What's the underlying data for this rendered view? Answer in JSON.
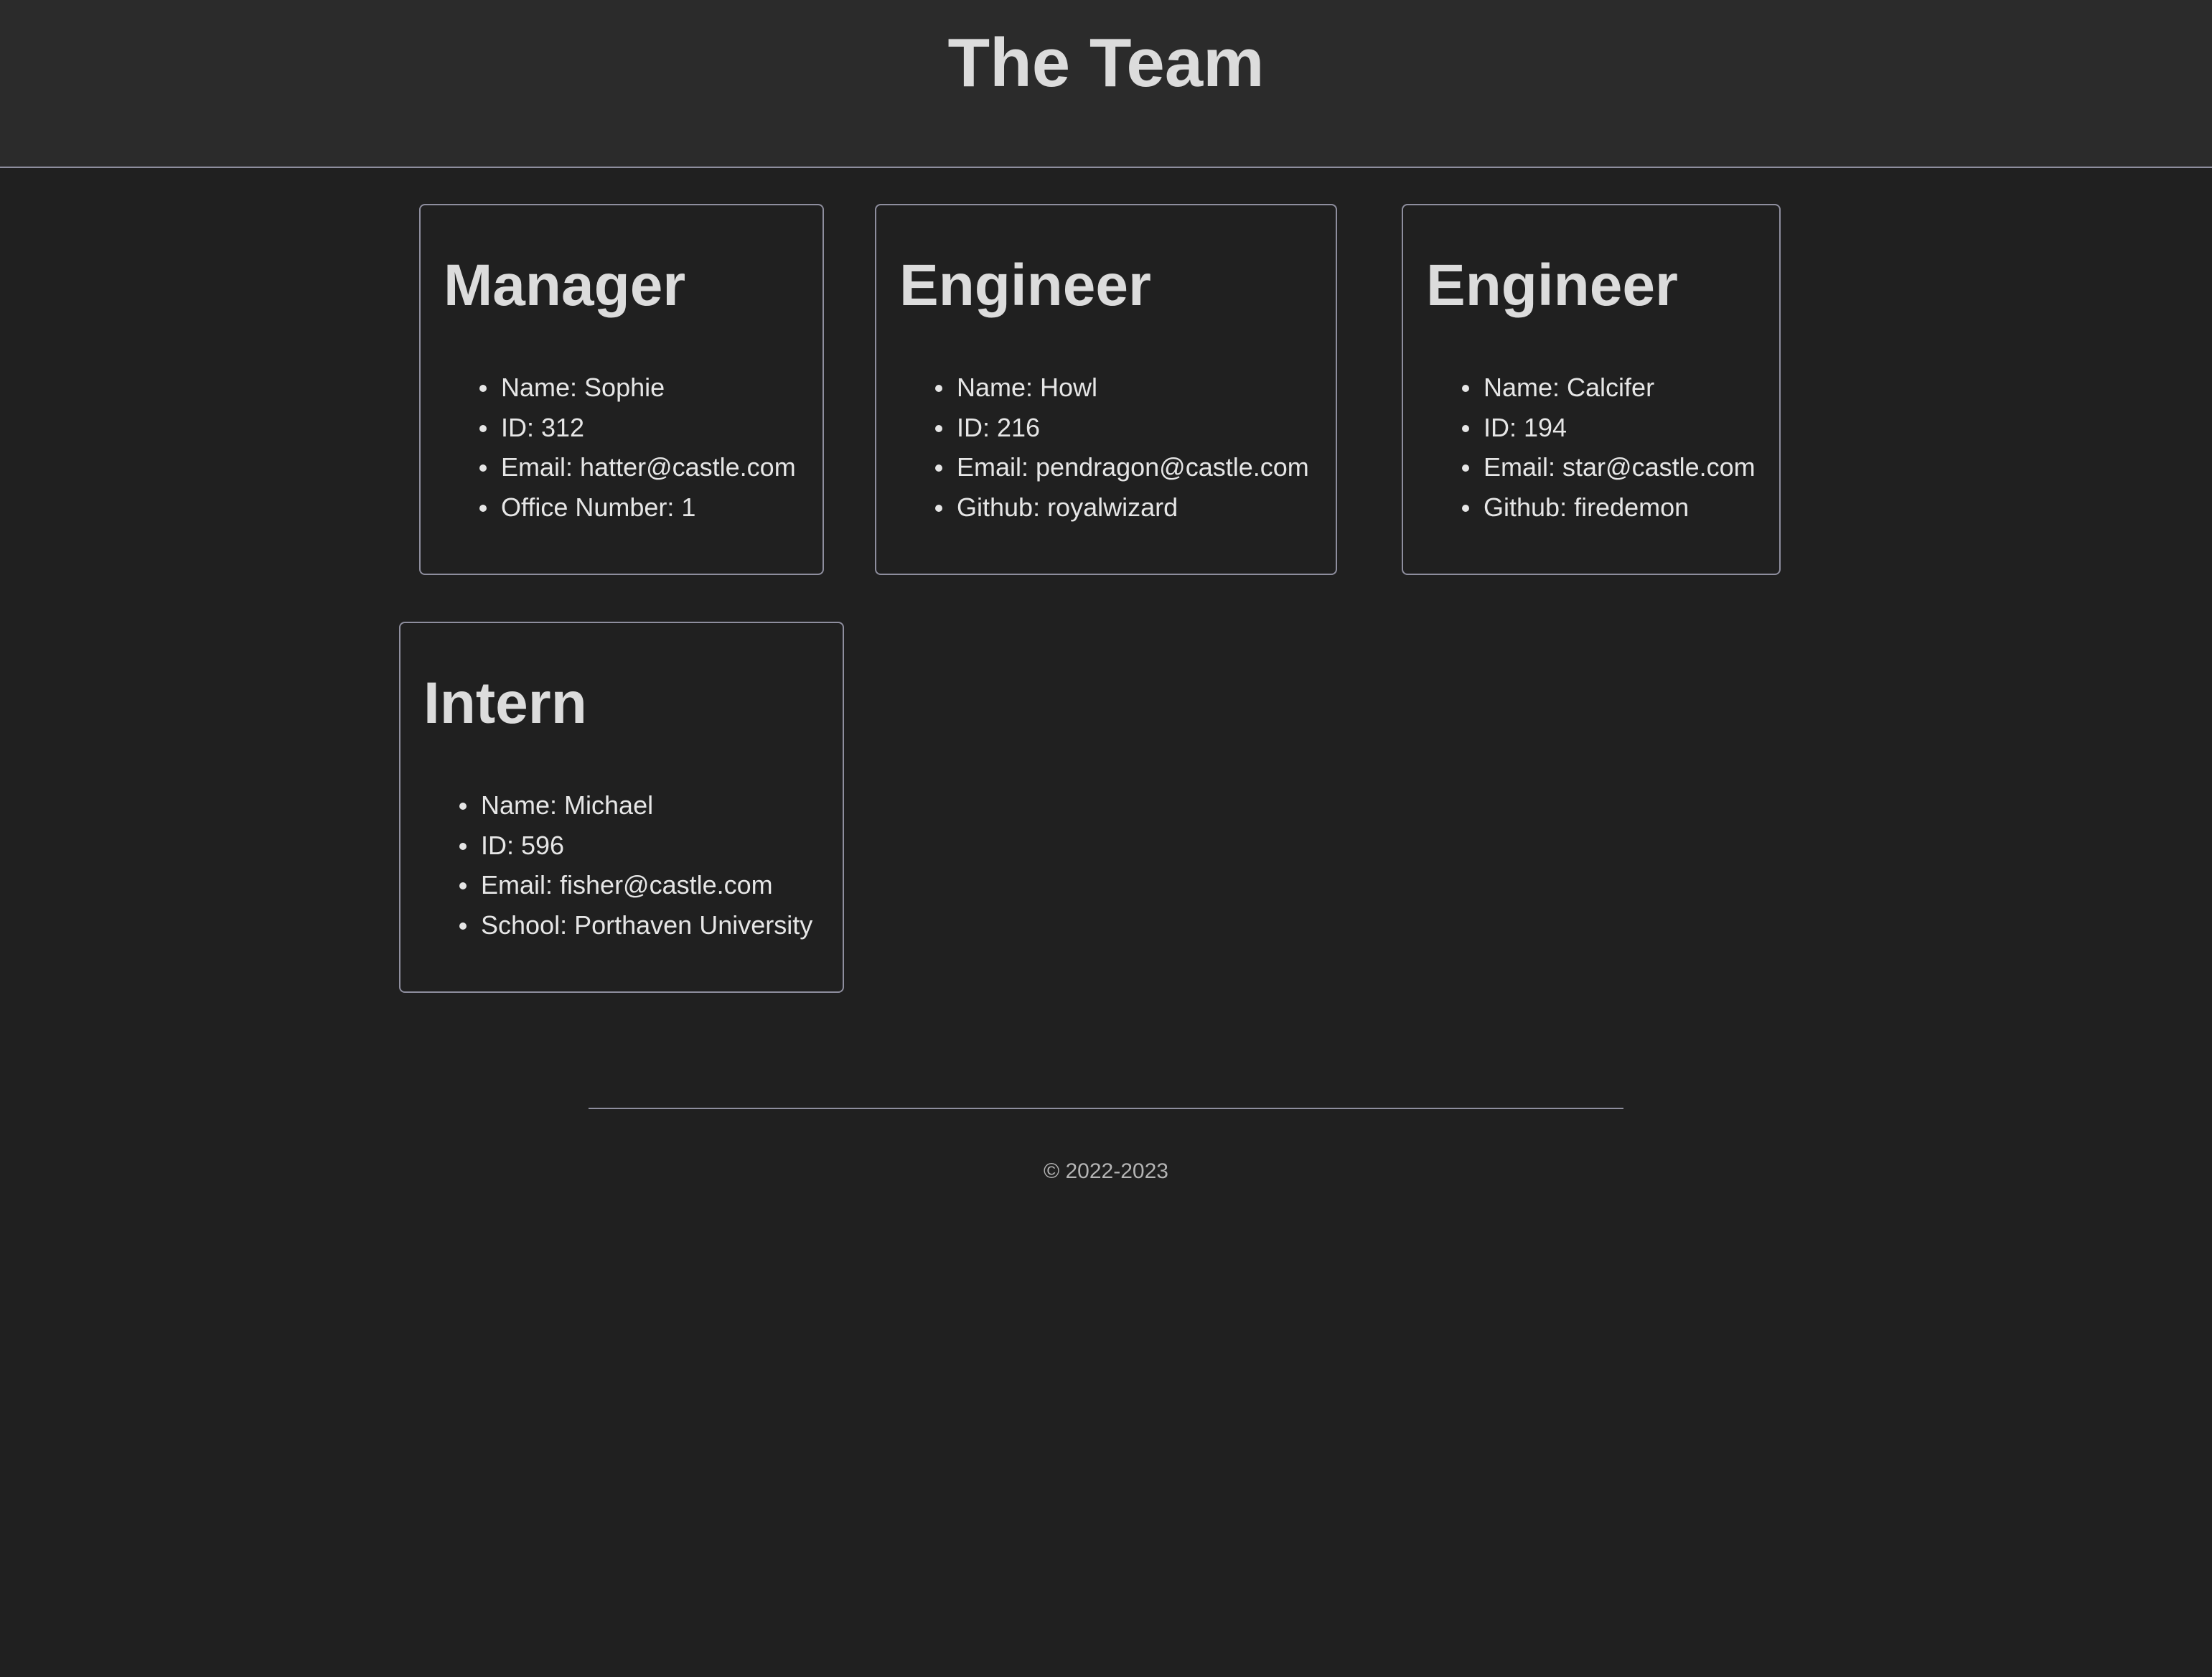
{
  "header": {
    "title": "The Team"
  },
  "cards": [
    {
      "role": "Manager",
      "items": [
        "Name: Sophie",
        "ID: 312",
        "Email: hatter@castle.com",
        "Office Number: 1"
      ]
    },
    {
      "role": "Engineer",
      "items": [
        "Name: Howl",
        "ID: 216",
        "Email: pendragon@castle.com",
        "Github: royalwizard"
      ]
    },
    {
      "role": "Engineer",
      "items": [
        "Name: Calcifer",
        "ID: 194",
        "Email: star@castle.com",
        "Github: firedemon"
      ]
    },
    {
      "role": "Intern",
      "items": [
        "Name: Michael",
        "ID: 596",
        "Email: fisher@castle.com",
        "School: Porthaven University"
      ]
    }
  ],
  "footer": {
    "copyright": "© 2022-2023"
  },
  "colors": {
    "background": "#202020",
    "header_background": "#2b2b2b",
    "border": "#8e8e9e",
    "text": "#e6e6e6"
  }
}
